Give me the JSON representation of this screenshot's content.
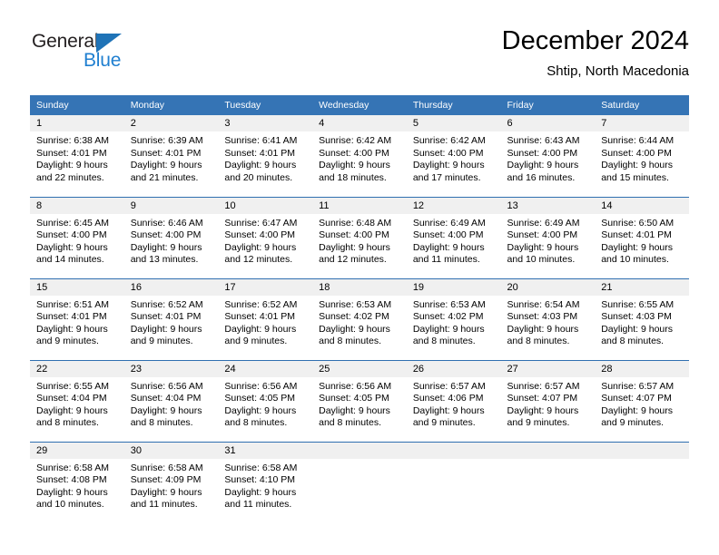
{
  "brand": {
    "name_dark": "General",
    "name_blue": "Blue",
    "triangle_color": "#1f73b7",
    "blue_color": "#1f7fd0"
  },
  "header": {
    "title": "December 2024",
    "subtitle": "Shtip, North Macedonia"
  },
  "theme": {
    "header_bg": "#3574b5",
    "row_divider": "#2f6fb0",
    "daynum_band_bg": "#f0f0f0"
  },
  "weekday_headers": [
    "Sunday",
    "Monday",
    "Tuesday",
    "Wednesday",
    "Thursday",
    "Friday",
    "Saturday"
  ],
  "weeks": [
    [
      {
        "day": "1",
        "sunrise": "Sunrise: 6:38 AM",
        "sunset": "Sunset: 4:01 PM",
        "daylight1": "Daylight: 9 hours",
        "daylight2": "and 22 minutes."
      },
      {
        "day": "2",
        "sunrise": "Sunrise: 6:39 AM",
        "sunset": "Sunset: 4:01 PM",
        "daylight1": "Daylight: 9 hours",
        "daylight2": "and 21 minutes."
      },
      {
        "day": "3",
        "sunrise": "Sunrise: 6:41 AM",
        "sunset": "Sunset: 4:01 PM",
        "daylight1": "Daylight: 9 hours",
        "daylight2": "and 20 minutes."
      },
      {
        "day": "4",
        "sunrise": "Sunrise: 6:42 AM",
        "sunset": "Sunset: 4:00 PM",
        "daylight1": "Daylight: 9 hours",
        "daylight2": "and 18 minutes."
      },
      {
        "day": "5",
        "sunrise": "Sunrise: 6:42 AM",
        "sunset": "Sunset: 4:00 PM",
        "daylight1": "Daylight: 9 hours",
        "daylight2": "and 17 minutes."
      },
      {
        "day": "6",
        "sunrise": "Sunrise: 6:43 AM",
        "sunset": "Sunset: 4:00 PM",
        "daylight1": "Daylight: 9 hours",
        "daylight2": "and 16 minutes."
      },
      {
        "day": "7",
        "sunrise": "Sunrise: 6:44 AM",
        "sunset": "Sunset: 4:00 PM",
        "daylight1": "Daylight: 9 hours",
        "daylight2": "and 15 minutes."
      }
    ],
    [
      {
        "day": "8",
        "sunrise": "Sunrise: 6:45 AM",
        "sunset": "Sunset: 4:00 PM",
        "daylight1": "Daylight: 9 hours",
        "daylight2": "and 14 minutes."
      },
      {
        "day": "9",
        "sunrise": "Sunrise: 6:46 AM",
        "sunset": "Sunset: 4:00 PM",
        "daylight1": "Daylight: 9 hours",
        "daylight2": "and 13 minutes."
      },
      {
        "day": "10",
        "sunrise": "Sunrise: 6:47 AM",
        "sunset": "Sunset: 4:00 PM",
        "daylight1": "Daylight: 9 hours",
        "daylight2": "and 12 minutes."
      },
      {
        "day": "11",
        "sunrise": "Sunrise: 6:48 AM",
        "sunset": "Sunset: 4:00 PM",
        "daylight1": "Daylight: 9 hours",
        "daylight2": "and 12 minutes."
      },
      {
        "day": "12",
        "sunrise": "Sunrise: 6:49 AM",
        "sunset": "Sunset: 4:00 PM",
        "daylight1": "Daylight: 9 hours",
        "daylight2": "and 11 minutes."
      },
      {
        "day": "13",
        "sunrise": "Sunrise: 6:49 AM",
        "sunset": "Sunset: 4:00 PM",
        "daylight1": "Daylight: 9 hours",
        "daylight2": "and 10 minutes."
      },
      {
        "day": "14",
        "sunrise": "Sunrise: 6:50 AM",
        "sunset": "Sunset: 4:01 PM",
        "daylight1": "Daylight: 9 hours",
        "daylight2": "and 10 minutes."
      }
    ],
    [
      {
        "day": "15",
        "sunrise": "Sunrise: 6:51 AM",
        "sunset": "Sunset: 4:01 PM",
        "daylight1": "Daylight: 9 hours",
        "daylight2": "and 9 minutes."
      },
      {
        "day": "16",
        "sunrise": "Sunrise: 6:52 AM",
        "sunset": "Sunset: 4:01 PM",
        "daylight1": "Daylight: 9 hours",
        "daylight2": "and 9 minutes."
      },
      {
        "day": "17",
        "sunrise": "Sunrise: 6:52 AM",
        "sunset": "Sunset: 4:01 PM",
        "daylight1": "Daylight: 9 hours",
        "daylight2": "and 9 minutes."
      },
      {
        "day": "18",
        "sunrise": "Sunrise: 6:53 AM",
        "sunset": "Sunset: 4:02 PM",
        "daylight1": "Daylight: 9 hours",
        "daylight2": "and 8 minutes."
      },
      {
        "day": "19",
        "sunrise": "Sunrise: 6:53 AM",
        "sunset": "Sunset: 4:02 PM",
        "daylight1": "Daylight: 9 hours",
        "daylight2": "and 8 minutes."
      },
      {
        "day": "20",
        "sunrise": "Sunrise: 6:54 AM",
        "sunset": "Sunset: 4:03 PM",
        "daylight1": "Daylight: 9 hours",
        "daylight2": "and 8 minutes."
      },
      {
        "day": "21",
        "sunrise": "Sunrise: 6:55 AM",
        "sunset": "Sunset: 4:03 PM",
        "daylight1": "Daylight: 9 hours",
        "daylight2": "and 8 minutes."
      }
    ],
    [
      {
        "day": "22",
        "sunrise": "Sunrise: 6:55 AM",
        "sunset": "Sunset: 4:04 PM",
        "daylight1": "Daylight: 9 hours",
        "daylight2": "and 8 minutes."
      },
      {
        "day": "23",
        "sunrise": "Sunrise: 6:56 AM",
        "sunset": "Sunset: 4:04 PM",
        "daylight1": "Daylight: 9 hours",
        "daylight2": "and 8 minutes."
      },
      {
        "day": "24",
        "sunrise": "Sunrise: 6:56 AM",
        "sunset": "Sunset: 4:05 PM",
        "daylight1": "Daylight: 9 hours",
        "daylight2": "and 8 minutes."
      },
      {
        "day": "25",
        "sunrise": "Sunrise: 6:56 AM",
        "sunset": "Sunset: 4:05 PM",
        "daylight1": "Daylight: 9 hours",
        "daylight2": "and 8 minutes."
      },
      {
        "day": "26",
        "sunrise": "Sunrise: 6:57 AM",
        "sunset": "Sunset: 4:06 PM",
        "daylight1": "Daylight: 9 hours",
        "daylight2": "and 9 minutes."
      },
      {
        "day": "27",
        "sunrise": "Sunrise: 6:57 AM",
        "sunset": "Sunset: 4:07 PM",
        "daylight1": "Daylight: 9 hours",
        "daylight2": "and 9 minutes."
      },
      {
        "day": "28",
        "sunrise": "Sunrise: 6:57 AM",
        "sunset": "Sunset: 4:07 PM",
        "daylight1": "Daylight: 9 hours",
        "daylight2": "and 9 minutes."
      }
    ],
    [
      {
        "day": "29",
        "sunrise": "Sunrise: 6:58 AM",
        "sunset": "Sunset: 4:08 PM",
        "daylight1": "Daylight: 9 hours",
        "daylight2": "and 10 minutes."
      },
      {
        "day": "30",
        "sunrise": "Sunrise: 6:58 AM",
        "sunset": "Sunset: 4:09 PM",
        "daylight1": "Daylight: 9 hours",
        "daylight2": "and 11 minutes."
      },
      {
        "day": "31",
        "sunrise": "Sunrise: 6:58 AM",
        "sunset": "Sunset: 4:10 PM",
        "daylight1": "Daylight: 9 hours",
        "daylight2": "and 11 minutes."
      },
      {
        "day": "",
        "sunrise": "",
        "sunset": "",
        "daylight1": "",
        "daylight2": ""
      },
      {
        "day": "",
        "sunrise": "",
        "sunset": "",
        "daylight1": "",
        "daylight2": ""
      },
      {
        "day": "",
        "sunrise": "",
        "sunset": "",
        "daylight1": "",
        "daylight2": ""
      },
      {
        "day": "",
        "sunrise": "",
        "sunset": "",
        "daylight1": "",
        "daylight2": ""
      }
    ]
  ]
}
